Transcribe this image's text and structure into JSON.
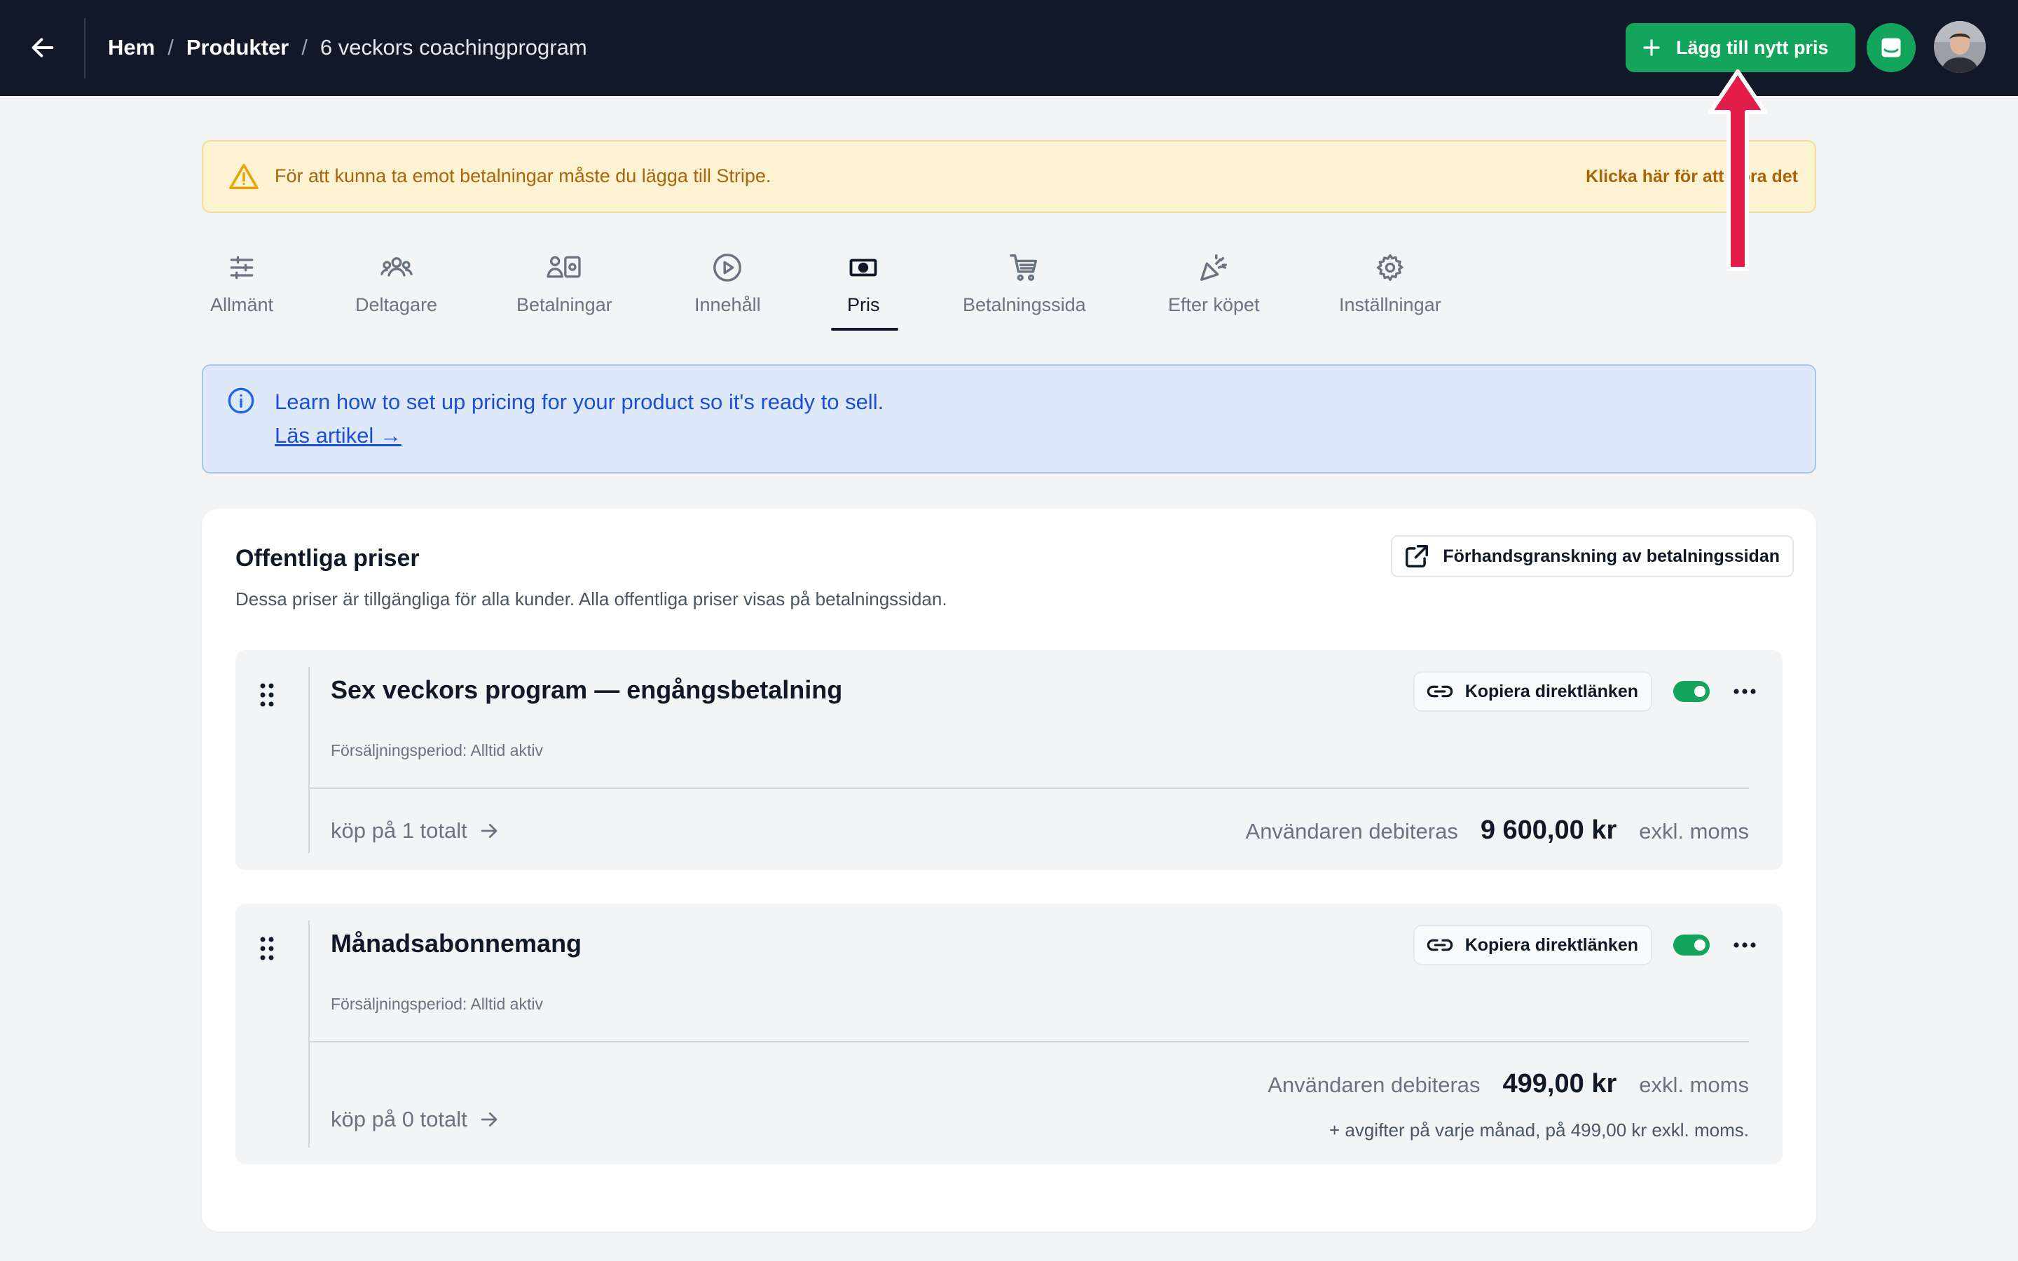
{
  "topbar": {
    "breadcrumbs": [
      "Hem",
      "Produkter",
      "6 veckors coachingprogram"
    ],
    "add_price_label": "Lägg till nytt pris"
  },
  "warning": {
    "text": "För att kunna ta emot betalningar måste du lägga till Stripe.",
    "link": "Klicka här för att göra det"
  },
  "tabs": [
    {
      "label": "Allmänt",
      "icon": "sliders-icon"
    },
    {
      "label": "Deltagare",
      "icon": "users-icon"
    },
    {
      "label": "Betalningar",
      "icon": "payments-icon"
    },
    {
      "label": "Innehåll",
      "icon": "play-icon"
    },
    {
      "label": "Pris",
      "icon": "banknote-icon",
      "active": true
    },
    {
      "label": "Betalningssida",
      "icon": "cart-icon"
    },
    {
      "label": "Efter köpet",
      "icon": "party-icon"
    },
    {
      "label": "Inställningar",
      "icon": "gear-icon"
    }
  ],
  "info": {
    "text": "Learn how to set up pricing for your product so it's ready to sell.",
    "link": "Läs artikel →"
  },
  "card": {
    "title": "Offentliga priser",
    "description": "Dessa priser är tillgängliga för alla kunder. Alla offentliga priser visas på betalningssidan.",
    "preview_label": "Förhandsgranskning av betalningssidan",
    "prices": [
      {
        "name": "Sex veckors program — engångsbetalning",
        "period": "Försäljningsperiod: Alltid aktiv",
        "copy_label": "Kopiera direktlänken",
        "enabled": true,
        "sales": "köp på 1 totalt",
        "charge_label": "Användaren debiteras",
        "amount": "9 600,00 kr",
        "tax": "exkl. moms"
      },
      {
        "name": "Månadsabonnemang",
        "period": "Försäljningsperiod: Alltid aktiv",
        "copy_label": "Kopiera direktlänken",
        "enabled": true,
        "sales": "köp på 0 totalt",
        "charge_label": "Användaren debiteras",
        "amount": "499,00 kr",
        "tax": "exkl. moms",
        "extra": "+ avgifter på varje månad, på 499,00 kr exkl. moms."
      }
    ]
  },
  "colors": {
    "topbar": "#111827",
    "accent_green": "#12a55b",
    "warning_bg": "#fdf2d1",
    "info_bg": "#dde9f8",
    "annotation_arrow": "#e11d48"
  }
}
